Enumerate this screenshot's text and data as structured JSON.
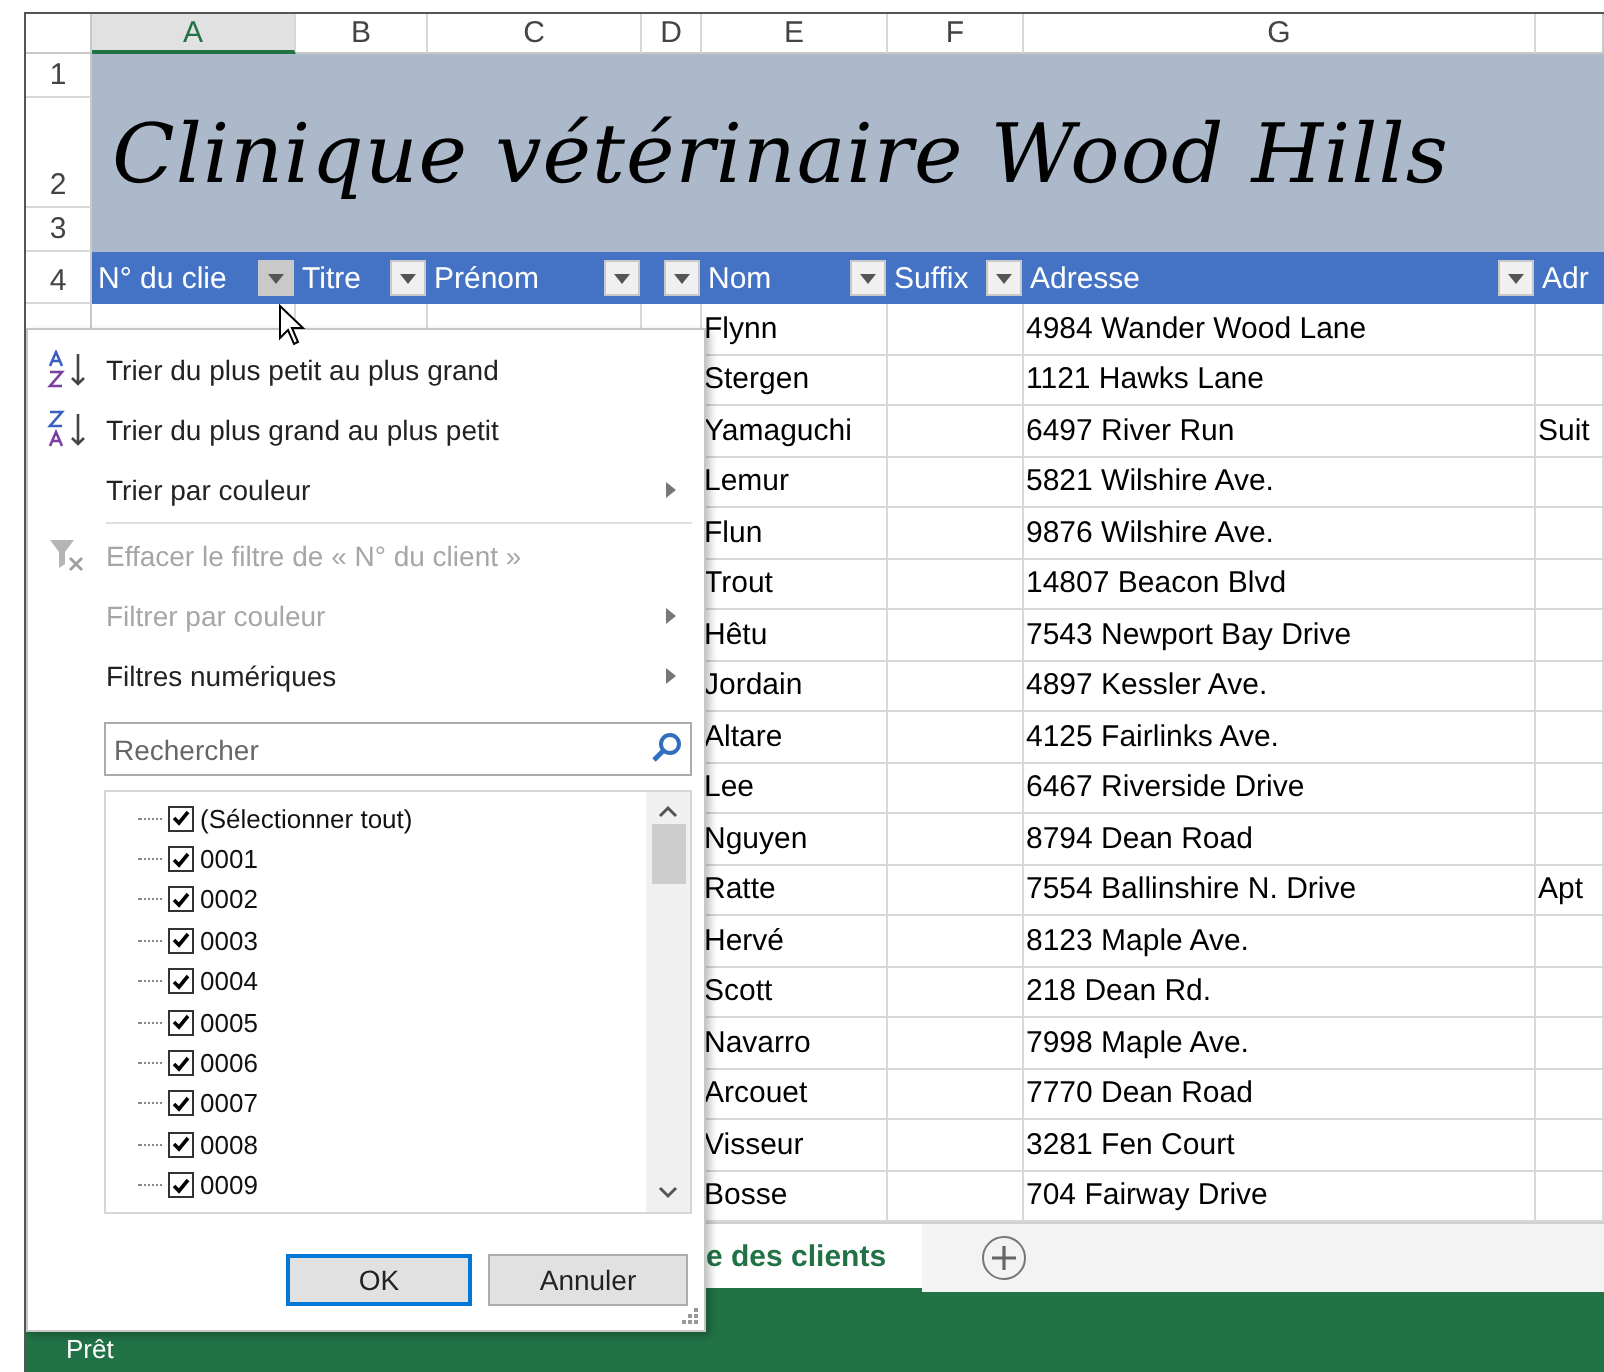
{
  "sheet": {
    "column_letters": [
      {
        "label": "A",
        "selected": true
      },
      {
        "label": "B",
        "selected": false
      },
      {
        "label": "C",
        "selected": false
      },
      {
        "label": "D",
        "selected": false
      },
      {
        "label": "E",
        "selected": false
      },
      {
        "label": "F",
        "selected": false
      },
      {
        "label": "G",
        "selected": false
      }
    ],
    "row_numbers": [
      "1",
      "2",
      "3",
      "4"
    ],
    "title": "Clinique vétérinaire Wood Hills",
    "columns": [
      {
        "label": "N° du clie",
        "filter_hovered": true
      },
      {
        "label": "Titre",
        "filter_hovered": false
      },
      {
        "label": "Prénom",
        "filter_hovered": false
      },
      {
        "filter_hovered": false
      },
      {
        "label": "Nom",
        "filter_hovered": false
      },
      {
        "label": "Suffix",
        "filter_hovered": false
      },
      {
        "label": "Adresse",
        "filter_hovered": false
      },
      {
        "label": "Adr"
      }
    ],
    "rows": [
      {
        "nom": "Flynn",
        "adresse": "4984 Wander Wood Lane"
      },
      {
        "nom": "Stergen",
        "adresse": "1121 Hawks Lane"
      },
      {
        "nom": "Yamaguchi",
        "adresse": "6497 River Run",
        "column_8": "Suit"
      },
      {
        "nom": "Lemur",
        "adresse": "5821 Wilshire Ave."
      },
      {
        "nom": "Flun",
        "adresse": "9876 Wilshire Ave."
      },
      {
        "nom": "Trout",
        "adresse": "14807 Beacon Blvd"
      },
      {
        "nom": "Hêtu",
        "adresse": "7543 Newport Bay Drive"
      },
      {
        "nom": "Jordain",
        "adresse": "4897 Kessler Ave."
      },
      {
        "nom": "Altare",
        "adresse": "4125 Fairlinks Ave."
      },
      {
        "nom": "Lee",
        "adresse": "6467 Riverside Drive"
      },
      {
        "nom": "Nguyen",
        "adresse": "8794 Dean Road"
      },
      {
        "nom": "Ratte",
        "adresse": "7554 Ballinshire N. Drive",
        "column_8": "Apt"
      },
      {
        "nom": "Hervé",
        "adresse": "8123 Maple Ave."
      },
      {
        "nom": "Scott",
        "adresse": "218 Dean Rd."
      },
      {
        "nom": "Navarro",
        "adresse": "7998 Maple Ave."
      },
      {
        "nom": "Arcouet",
        "adresse": "7770 Dean Road"
      },
      {
        "nom": "Visseur",
        "adresse": "3281 Fen Court"
      },
      {
        "nom": "Bosse",
        "adresse": "704 Fairway Drive"
      }
    ],
    "tabs": [
      {
        "label": "e des clients",
        "selected": true
      }
    ],
    "status": "Prêt"
  },
  "filter_menu": {
    "items": [
      {
        "kind": "ascending",
        "label": "Trier du plus petit au plus grand",
        "disabled": false,
        "submenu": false
      },
      {
        "kind": "descending",
        "label": "Trier du plus grand au plus petit",
        "disabled": false,
        "submenu": false
      },
      {
        "kind": "plain",
        "label": "Trier par couleur",
        "disabled": false,
        "submenu": true
      },
      {
        "kind": "divider"
      },
      {
        "kind": "clearing",
        "label": "Effacer le filtre de « N° du client »",
        "disabled": true,
        "submenu": false
      },
      {
        "kind": "plain",
        "label": "Filtrer par couleur",
        "disabled": true,
        "submenu": true
      },
      {
        "kind": "plain",
        "label": "Filtres numériques",
        "disabled": false,
        "submenu": true
      }
    ],
    "search": {
      "placeholder": "Rechercher"
    },
    "values": [
      {
        "label": "(Sélectionner tout)",
        "checked": true
      },
      {
        "label": "0001",
        "checked": true
      },
      {
        "label": "0002",
        "checked": true
      },
      {
        "label": "0003",
        "checked": true
      },
      {
        "label": "0004",
        "checked": true
      },
      {
        "label": "0005",
        "checked": true
      },
      {
        "label": "0006",
        "checked": true
      },
      {
        "label": "0007",
        "checked": true
      },
      {
        "label": "0008",
        "checked": true
      },
      {
        "label": "0009",
        "checked": true
      }
    ],
    "buttons": [
      {
        "label": "OK",
        "default": true
      },
      {
        "label": "Annuler",
        "default": false
      }
    ]
  }
}
